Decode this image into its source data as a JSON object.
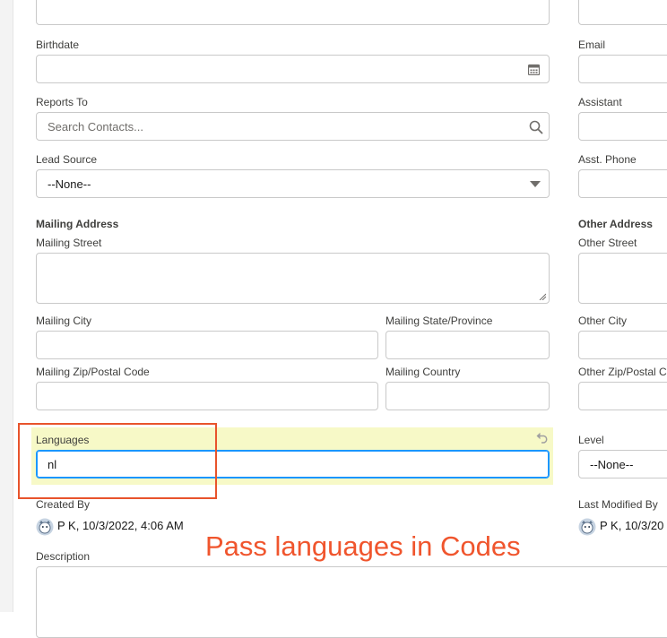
{
  "left_column": {
    "birthdate": {
      "label": "Birthdate",
      "value": ""
    },
    "reports_to": {
      "label": "Reports To",
      "placeholder": "Search Contacts..."
    },
    "lead_source": {
      "label": "Lead Source",
      "value": "--None--"
    },
    "mailing_address_title": "Mailing Address",
    "mailing_street": {
      "label": "Mailing Street",
      "value": ""
    },
    "mailing_city": {
      "label": "Mailing City",
      "value": ""
    },
    "mailing_state": {
      "label": "Mailing State/Province",
      "value": ""
    },
    "mailing_zip": {
      "label": "Mailing Zip/Postal Code",
      "value": ""
    },
    "mailing_country": {
      "label": "Mailing Country",
      "value": ""
    },
    "languages": {
      "label": "Languages",
      "value": "nl"
    },
    "created_by": {
      "label": "Created By",
      "value": "P K, 10/3/2022, 4:06 AM"
    },
    "description": {
      "label": "Description",
      "value": ""
    }
  },
  "right_column": {
    "email": {
      "label": "Email"
    },
    "assistant": {
      "label": "Assistant"
    },
    "asst_phone": {
      "label": "Asst. Phone"
    },
    "other_address_title": "Other Address",
    "other_street": {
      "label": "Other Street"
    },
    "other_city": {
      "label": "Other City"
    },
    "other_zip": {
      "label": "Other Zip/Postal C"
    },
    "level": {
      "label": "Level",
      "value": "--None--"
    },
    "last_modified_by": {
      "label": "Last Modified By",
      "value": "P K, 10/3/20"
    }
  },
  "annotation": {
    "text": "Pass languages in Codes",
    "color": "#f0552d"
  },
  "icons": [
    "calendar-icon",
    "search-icon",
    "dropdown-arrow-icon",
    "undo-icon",
    "avatar-icon"
  ]
}
